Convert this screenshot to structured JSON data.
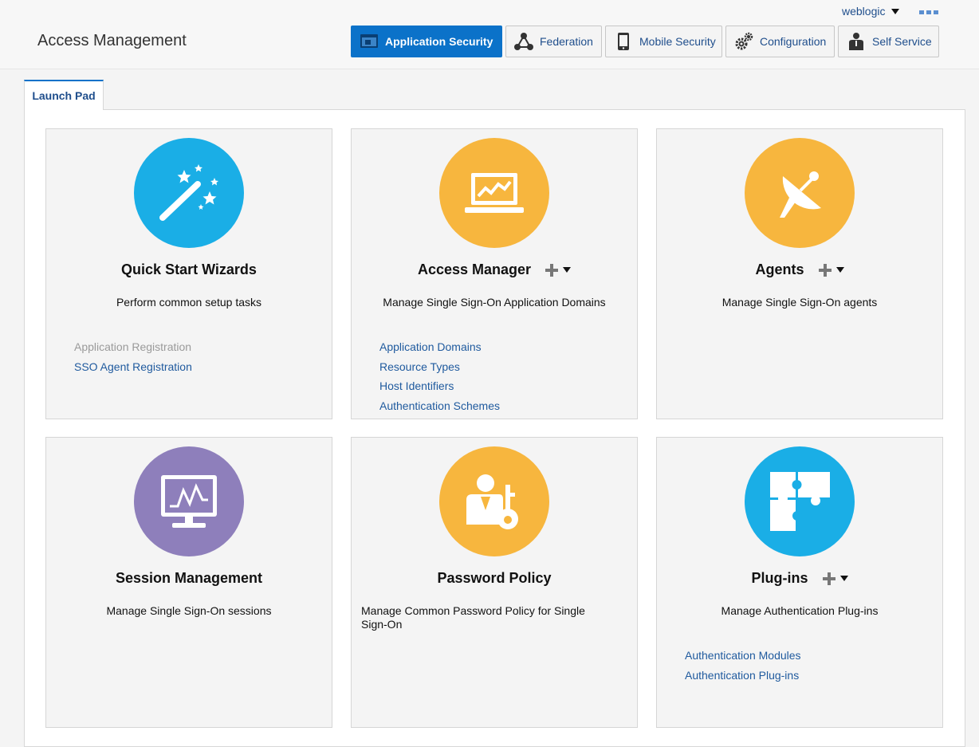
{
  "header": {
    "title": "Access Management",
    "user": "weblogic",
    "nav": [
      {
        "label": "Application Security",
        "icon": "application-security-icon",
        "active": true
      },
      {
        "label": "Federation",
        "icon": "federation-icon"
      },
      {
        "label": "Mobile Security",
        "icon": "mobile-icon"
      },
      {
        "label": "Configuration",
        "icon": "gears-icon"
      },
      {
        "label": "Self Service",
        "icon": "person-icon"
      }
    ]
  },
  "tabs": [
    {
      "label": "Launch Pad",
      "active": true
    }
  ],
  "colors": {
    "accent": "#0b72c9",
    "blue_circle": "#1aaee6",
    "orange_circle": "#f7b63e",
    "purple_circle": "#8e7fbb",
    "link": "#1f5a9e"
  },
  "cards": [
    {
      "title": "Quick Start Wizards",
      "description": "Perform common setup tasks",
      "icon": "magic-wand-icon",
      "links": [
        {
          "label": "Application Registration",
          "disabled": true
        },
        {
          "label": "SSO Agent Registration"
        }
      ]
    },
    {
      "title": "Access Manager",
      "description": "Manage Single Sign-On Application Domains",
      "icon": "laptop-chart-icon",
      "has_add": true,
      "links": [
        {
          "label": "Application Domains"
        },
        {
          "label": "Resource Types"
        },
        {
          "label": "Host Identifiers"
        },
        {
          "label": "Authentication Schemes"
        }
      ]
    },
    {
      "title": "Agents",
      "description": "Manage Single Sign-On agents",
      "icon": "satellite-dish-icon",
      "has_add": true,
      "links": []
    },
    {
      "title": "Session Management",
      "description": "Manage Single Sign-On sessions",
      "icon": "monitor-pulse-icon",
      "links": []
    },
    {
      "title": "Password Policy",
      "description": "Manage Common Password Policy for Single Sign-On",
      "icon": "user-key-icon",
      "links": []
    },
    {
      "title": "Plug-ins",
      "description": "Manage Authentication Plug-ins",
      "icon": "puzzle-icon",
      "has_add": true,
      "links": [
        {
          "label": "Authentication Modules"
        },
        {
          "label": "Authentication Plug-ins"
        }
      ]
    }
  ]
}
